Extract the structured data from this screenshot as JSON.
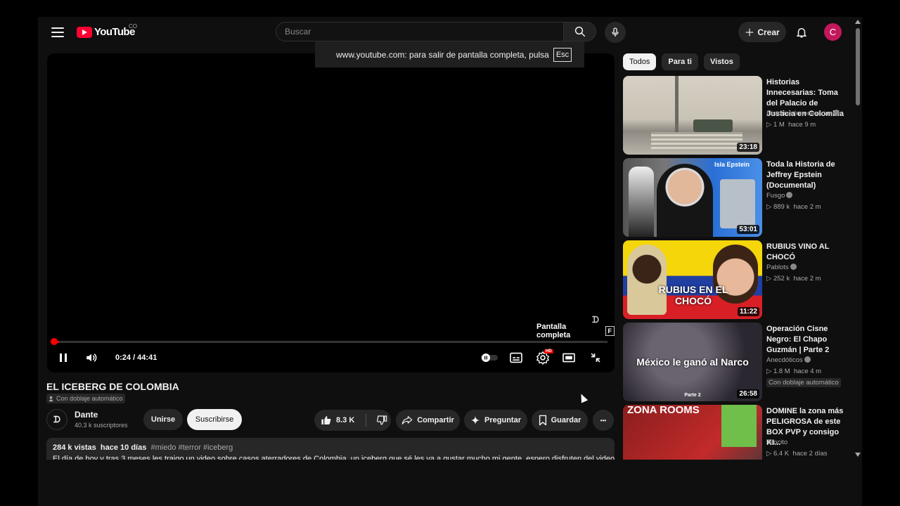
{
  "header": {
    "logo_text": "YouTube",
    "country_code": "CO",
    "search_placeholder": "Buscar",
    "create_label": "Crear",
    "avatar_letter": "C"
  },
  "fullscreen_notice": {
    "text": "www.youtube.com: para salir de pantalla completa, pulsa",
    "key": "Esc"
  },
  "player": {
    "time": "0:24 / 44:41",
    "progress_fraction": 0.009,
    "fullscreen_tip": "Pantalla completa",
    "fullscreen_key": "F",
    "watermark": "ᗪ",
    "hd_badge": "HD"
  },
  "video": {
    "title": "EL ICEBERG DE COLOMBIA",
    "dub_badge": "Con doblaje automático",
    "channel": {
      "name": "Dante",
      "subscribers": "40.3 k suscriptores",
      "avatar_text": "ᗪ"
    },
    "join_label": "Unirse",
    "subscribe_label": "Suscribirse",
    "likes": "8.3 K",
    "share_label": "Compartir",
    "ask_label": "Preguntar",
    "save_label": "Guardar",
    "more_label": "•••",
    "description": {
      "views": "284 k vistas",
      "age": "hace 10 días",
      "tags": "#miedo #terror #iceberg",
      "text": "El día de hoy y tras 3 meses les traigo un video sobre casos aterradores de Colombia, un iceberg que sé les va a gustar mucho mi gente, espero disfruten del video"
    }
  },
  "sidebar": {
    "chips": [
      {
        "label": "Todos",
        "active": true
      },
      {
        "label": "Para ti",
        "active": false
      },
      {
        "label": "Vistos",
        "active": false
      }
    ],
    "recommendations": [
      {
        "title": "Historias Innecesarias: Toma del Palacio de Justicia en Colombia",
        "channel": "Historias Innecesarias",
        "views": "1 M",
        "age": "hace 9 m",
        "duration": "23:18",
        "badge": ""
      },
      {
        "title": "Toda la Historia de Jeffrey Epstein (Documental)",
        "channel": "Fusgo",
        "views": "889 k",
        "age": "hace 2 m",
        "duration": "53:01",
        "badge": "",
        "thumb_text": "Isla Epstein"
      },
      {
        "title": "RUBIUS VINO AL CHOCÓ",
        "channel": "Pablots",
        "views": "252 k",
        "age": "hace 2 m",
        "duration": "11:22",
        "badge": "",
        "thumb_text": "RUBIUS EN EL CHOCÓ"
      },
      {
        "title": "Operación Cisne Negro: El Chapo Guzmán | Parte 2",
        "channel": "Anecdóticos",
        "views": "1.8 M",
        "age": "hace 4 m",
        "duration": "26:58",
        "badge": "Con doblaje automático",
        "thumb_text": "México le ganó al Narco",
        "thumb_sub": "Parte 2"
      },
      {
        "title": "DOMINE la zona más PELIGROSA de este BOX PVP y consigo KI...",
        "channel": "Tencito",
        "views": "6.4 K",
        "age": "hace 2 días",
        "duration": "",
        "badge": "",
        "thumb_text": "ZONA ROOMS"
      }
    ]
  }
}
